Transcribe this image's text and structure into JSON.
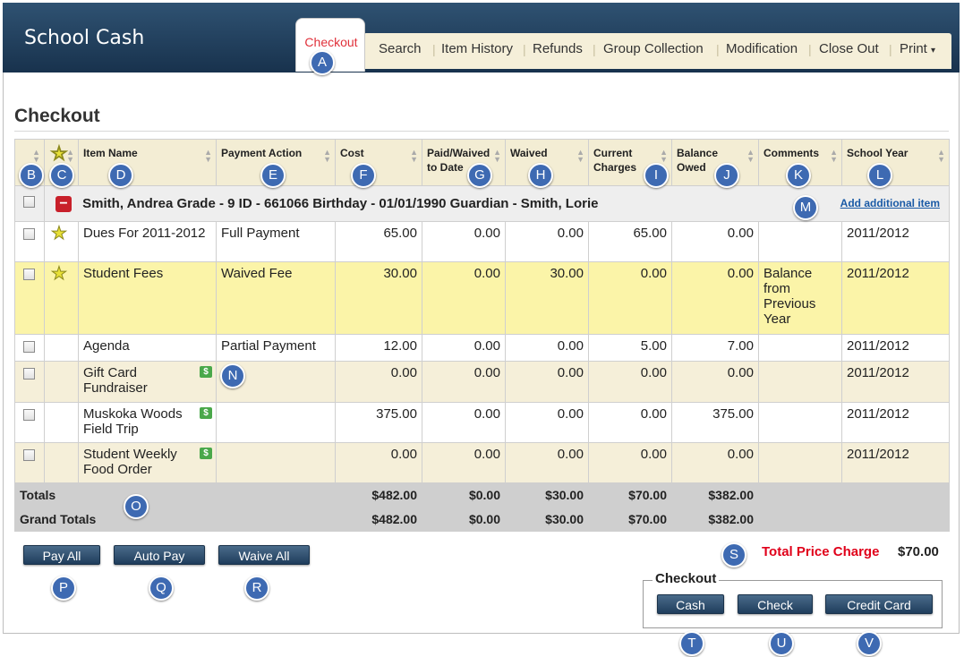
{
  "app": {
    "title": "School Cash"
  },
  "nav": {
    "active_tab": "Checkout",
    "tabs": [
      "Search",
      "Item History",
      "Refunds",
      "Group Collection",
      "Modification",
      "Close Out",
      "Print"
    ],
    "print_caret": "▾"
  },
  "page": {
    "title": "Checkout"
  },
  "table": {
    "headers": {
      "item_name": "Item Name",
      "payment_action": "Payment Action",
      "cost": "Cost",
      "paid_line1": "Paid/Waived",
      "paid_line2": "to Date",
      "waived": "Waived",
      "current_line1": "Current",
      "current_line2": "Charges",
      "balance_line1": "Balance",
      "balance_line2": "Owed",
      "comments": "Comments",
      "school_year": "School Year"
    },
    "student": {
      "label": "Smith, Andrea Grade - 9 ID - 661066 Birthday - 01/01/1990 Guardian - Smith, Lorie",
      "add_link": "Add additional item"
    },
    "rows": [
      {
        "item": "Dues For 2011-2012",
        "action": "Full Payment",
        "cost": "65.00",
        "paid": "0.00",
        "waived": "0.00",
        "current": "65.00",
        "balance": "0.00",
        "comments": "",
        "year": "2011/2012"
      },
      {
        "item": "Student Fees",
        "action": "Waived Fee",
        "cost": "30.00",
        "paid": "0.00",
        "waived": "30.00",
        "current": "0.00",
        "balance": "0.00",
        "comments": "Balance from Previous Year",
        "year": "2011/2012"
      },
      {
        "item": "Agenda",
        "action": "Partial Payment",
        "cost": "12.00",
        "paid": "0.00",
        "waived": "0.00",
        "current": "5.00",
        "balance": "7.00",
        "comments": "",
        "year": "2011/2012"
      },
      {
        "item": "Gift Card Fundraiser",
        "action": "",
        "cost": "0.00",
        "paid": "0.00",
        "waived": "0.00",
        "current": "0.00",
        "balance": "0.00",
        "comments": "",
        "year": "2011/2012"
      },
      {
        "item": "Muskoka Woods Field Trip",
        "action": "",
        "cost": "375.00",
        "paid": "0.00",
        "waived": "0.00",
        "current": "0.00",
        "balance": "375.00",
        "comments": "",
        "year": "2011/2012"
      },
      {
        "item": "Student Weekly Food Order",
        "action": "",
        "cost": "0.00",
        "paid": "0.00",
        "waived": "0.00",
        "current": "0.00",
        "balance": "0.00",
        "comments": "",
        "year": "2011/2012"
      }
    ],
    "totals": {
      "label": "Totals",
      "cost": "$482.00",
      "paid": "$0.00",
      "waived": "$30.00",
      "current": "$70.00",
      "balance": "$382.00"
    },
    "grand_totals": {
      "label": "Grand Totals",
      "cost": "$482.00",
      "paid": "$0.00",
      "waived": "$30.00",
      "current": "$70.00",
      "balance": "$382.00"
    }
  },
  "actions": {
    "pay_all": "Pay All",
    "auto_pay": "Auto Pay",
    "waive_all": "Waive All"
  },
  "summary": {
    "total_label": "Total Price Charge",
    "total_value": "$70.00"
  },
  "checkout": {
    "legend": "Checkout",
    "cash": "Cash",
    "check": "Check",
    "credit_card": "Credit Card"
  },
  "markers": [
    "A",
    "B",
    "C",
    "D",
    "E",
    "F",
    "G",
    "H",
    "I",
    "J",
    "K",
    "L",
    "M",
    "N",
    "O",
    "P",
    "Q",
    "R",
    "S",
    "T",
    "U",
    "V"
  ],
  "icons": {
    "star": "star-icon",
    "collapse": "minus-icon",
    "money": "dollar-icon",
    "sort": "sort-icon"
  },
  "colors": {
    "header_bg": "#1f3b57",
    "active_tab_text": "#e0303a",
    "highlight_row": "#fbf4a8",
    "marker": "#3e6ab2",
    "total_price": "#e0001a"
  }
}
